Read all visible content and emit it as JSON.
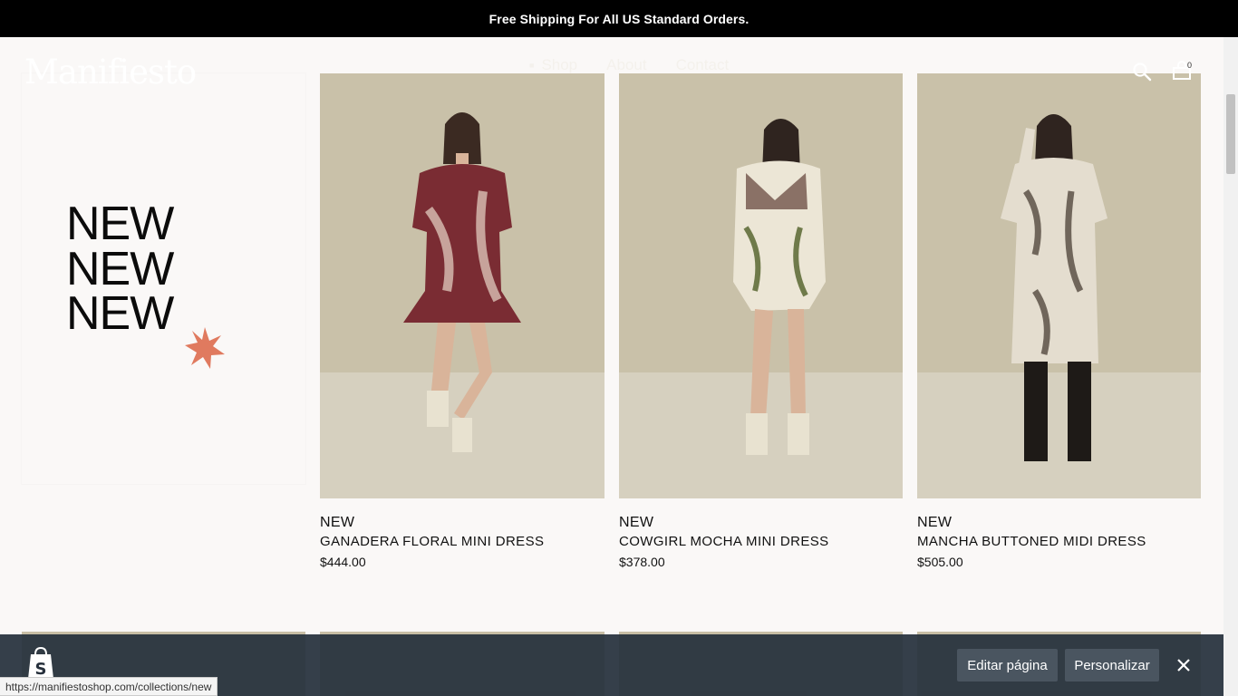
{
  "announcement": "Free Shipping For All US Standard Orders.",
  "header": {
    "logo": "Manifiesto",
    "nav": [
      {
        "label": "Shop"
      },
      {
        "label": "About"
      },
      {
        "label": "Contact"
      }
    ],
    "cart_count": "0"
  },
  "hero": {
    "lines": [
      "NEW",
      "NEW",
      "NEW"
    ],
    "accent_color": "#e07a5f"
  },
  "products": [
    {
      "badge": "NEW",
      "name": "GANADERA FLORAL MINI DRESS",
      "price": "$444.00"
    },
    {
      "badge": "NEW",
      "name": "COWGIRL MOCHA MINI DRESS",
      "price": "$378.00"
    },
    {
      "badge": "NEW",
      "name": "MANCHA BUTTONED MIDI DRESS",
      "price": "$505.00"
    }
  ],
  "admin_bar": {
    "edit_page": "Editar página",
    "customize": "Personalizar"
  },
  "status_url": "https://manifiestoshop.com/collections/new",
  "colors": {
    "announce_bg": "#000000",
    "admin_bg": "#26303c",
    "photo_bg": "#c9c1a9"
  }
}
